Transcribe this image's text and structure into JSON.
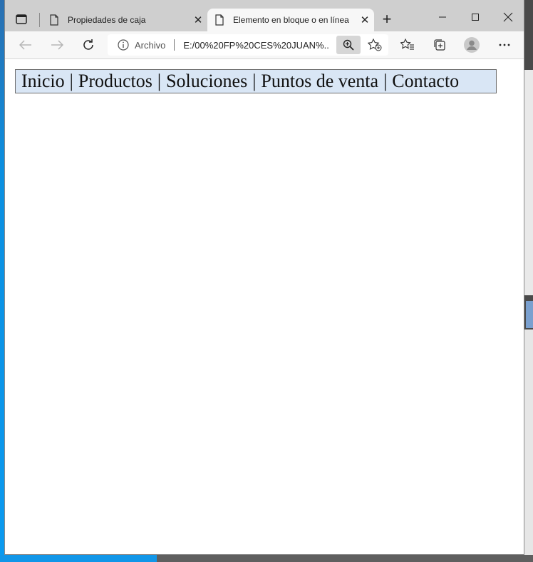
{
  "browser": {
    "tabs": [
      {
        "title": "Propiedades de caja",
        "active": false
      },
      {
        "title": "Elemento en bloque o en línea",
        "active": true
      }
    ],
    "address": {
      "scheme_label": "Archivo",
      "url": "E:/00%20FP%20CES%20JUAN%..."
    }
  },
  "page": {
    "nav": {
      "items": [
        "Inicio",
        "Productos",
        "Soluciones",
        "Puntos de venta",
        "Contacto"
      ],
      "separator": "|"
    }
  },
  "colors": {
    "nav_background": "#d9e6f5",
    "tabstrip": "#cfcfcf",
    "active_tab": "#f7f7f7"
  }
}
